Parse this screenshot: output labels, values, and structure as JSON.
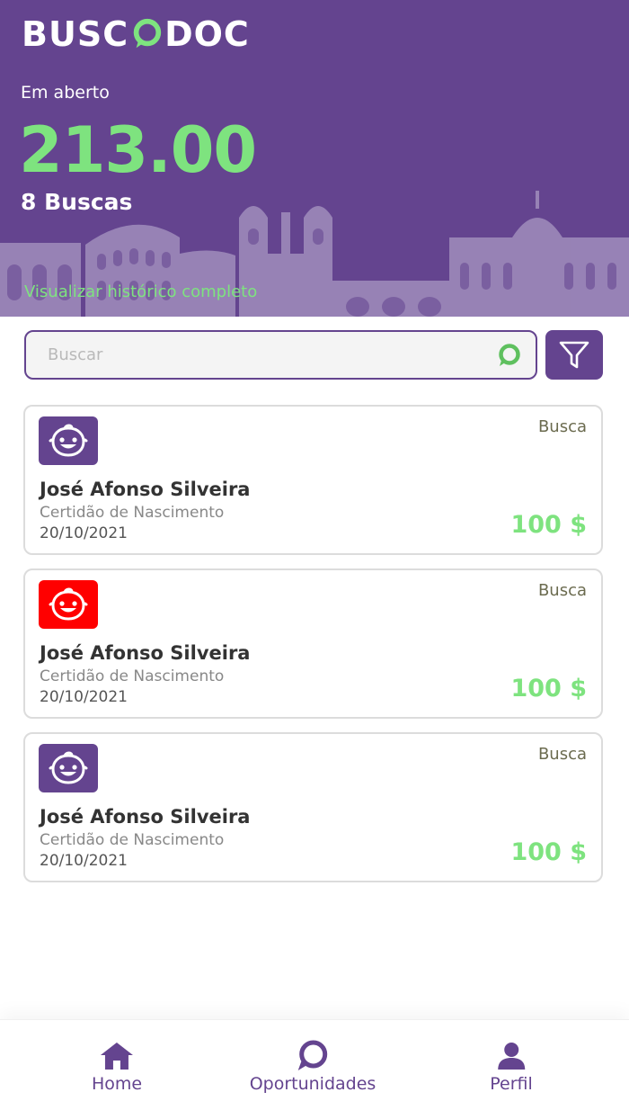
{
  "app": {
    "logo_left": "BUSC",
    "logo_right": "DOC"
  },
  "summary": {
    "open_label": "Em aberto",
    "amount": "213.00",
    "count": "8 Buscas",
    "history_link": "Visualizar histórico completo"
  },
  "search": {
    "placeholder": "Buscar",
    "icon": "search-icon",
    "filter_icon": "filter-icon"
  },
  "cards": [
    {
      "icon": "baby-face-icon",
      "icon_color": "#64448f",
      "type": "Busca",
      "name": "José Afonso Silveira",
      "document": "Certidão de Nascimento",
      "date": "20/10/2021",
      "price": "100 $"
    },
    {
      "icon": "baby-face-icon",
      "icon_color": "#ff0000",
      "type": "Busca",
      "name": "José Afonso Silveira",
      "document": "Certidão de Nascimento",
      "date": "20/10/2021",
      "price": "100 $"
    },
    {
      "icon": "baby-face-icon",
      "icon_color": "#64448f",
      "type": "Busca",
      "name": "José Afonso Silveira",
      "document": "Certidão de Nascimento",
      "date": "20/10/2021",
      "price": "100 $"
    }
  ],
  "nav": [
    {
      "label": "Home",
      "icon": "home-icon"
    },
    {
      "label": "Oportunidades",
      "icon": "chat-search-icon"
    },
    {
      "label": "Perfil",
      "icon": "user-icon"
    }
  ],
  "colors": {
    "brand_purple": "#64448f",
    "accent_green": "#7ee37f",
    "alert_red": "#ff0000"
  }
}
